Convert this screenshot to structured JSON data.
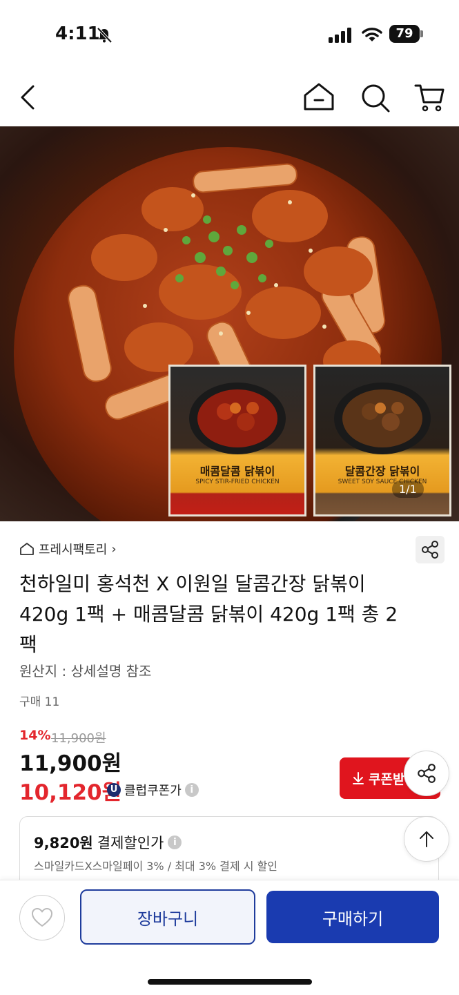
{
  "status": {
    "time": "4:11",
    "battery": "79"
  },
  "gallery": {
    "counter": "1/1",
    "pack1_title": "매콤달콤 닭볶이",
    "pack1_sub": "SPICY STIR-FRIED CHICKEN",
    "pack2_title": "달콤간장 닭볶이",
    "pack2_sub": "SWEET SOY SAUCE CHICKEN"
  },
  "store": {
    "name": "프레시팩토리",
    "chevron": "›"
  },
  "product": {
    "title": "천하일미 홍석천 X 이원일 달콤간장 닭볶이 420g 1팩 + 매콤달콤 닭볶이 420g 1팩 총 2팩",
    "origin": "원산지 : 상세설명 참조",
    "purchase_count": "구매 11"
  },
  "pricing": {
    "discount_rate": "14%",
    "original_price": "11,900원",
    "price": "11,900원",
    "coupon_price": "10,120원",
    "club_badge_letter": "U",
    "club_label": "클럽쿠폰가",
    "info_glyph": "i",
    "coupon_button": "쿠폰받"
  },
  "payment": {
    "amount": "9,820원",
    "label": "결제할인가",
    "detail": "스마일카드X스마일페이 3% / 최대 3% 결제 시 할인"
  },
  "actions": {
    "cart": "장바구니",
    "buy": "구매하기"
  },
  "colors": {
    "accent_red": "#e0151e",
    "brand_blue": "#1a3bb0"
  }
}
